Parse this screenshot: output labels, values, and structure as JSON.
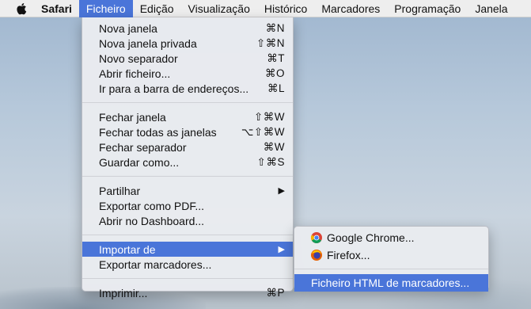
{
  "menubar": {
    "app_name": "Safari",
    "items": [
      "Ficheiro",
      "Edição",
      "Visualização",
      "Histórico",
      "Marcadores",
      "Programação",
      "Janela"
    ]
  },
  "file_menu": {
    "groups": [
      [
        {
          "label": "Nova janela",
          "shortcut": "⌘N"
        },
        {
          "label": "Nova janela privada",
          "shortcut": "⇧⌘N"
        },
        {
          "label": "Novo separador",
          "shortcut": "⌘T"
        },
        {
          "label": "Abrir ficheiro...",
          "shortcut": "⌘O"
        },
        {
          "label": "Ir para a barra de endereços...",
          "shortcut": "⌘L"
        }
      ],
      [
        {
          "label": "Fechar janela",
          "shortcut": "⇧⌘W"
        },
        {
          "label": "Fechar todas as janelas",
          "shortcut": "⌥⇧⌘W"
        },
        {
          "label": "Fechar separador",
          "shortcut": "⌘W"
        },
        {
          "label": "Guardar como...",
          "shortcut": "⇧⌘S"
        }
      ],
      [
        {
          "label": "Partilhar",
          "submenu_arrow": "▶"
        },
        {
          "label": "Exportar como PDF..."
        },
        {
          "label": "Abrir no Dashboard..."
        }
      ],
      [
        {
          "label": "Importar de",
          "submenu_arrow": "▶"
        },
        {
          "label": "Exportar marcadores..."
        }
      ],
      [
        {
          "label": "Imprimir...",
          "shortcut": "⌘P"
        }
      ]
    ]
  },
  "import_submenu": {
    "items": [
      {
        "label": "Google Chrome...",
        "icon": "chrome-icon"
      },
      {
        "label": "Firefox...",
        "icon": "firefox-icon"
      },
      {
        "label": "Ficheiro HTML de marcadores..."
      }
    ]
  },
  "colors": {
    "highlight": "#4a75d9",
    "menubar": "#eeeeee",
    "menu_bg": "#e9ebf0"
  }
}
